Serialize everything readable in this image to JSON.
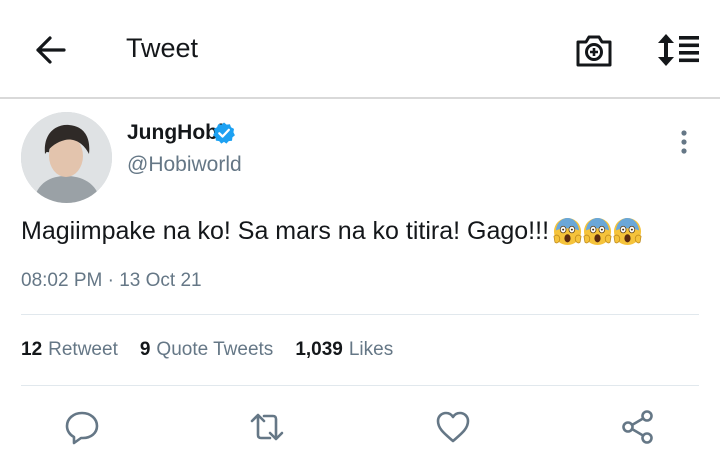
{
  "header": {
    "title": "Tweet",
    "back_icon": "arrow-left-icon",
    "camera_icon": "camera-plus-icon",
    "sort_icon": "sort-list-icon"
  },
  "tweet": {
    "display_name": "JungHobi",
    "verified": true,
    "handle": "@Hobiworld",
    "text": "Magiimpake na ko! Sa mars na ko titira! Gago!!!",
    "emojis": [
      "😱",
      "😱",
      "😱"
    ],
    "timestamp": "08:02 PM · 13 Oct 21"
  },
  "stats": [
    {
      "count": "12",
      "label": "Retweet"
    },
    {
      "count": "9",
      "label": "Quote Tweets"
    },
    {
      "count": "1,039",
      "label": "Likes"
    }
  ],
  "actions": [
    "reply-icon",
    "retweet-icon",
    "like-icon",
    "share-icon"
  ],
  "colors": {
    "verified": "#1da1f2",
    "secondary_text": "#657786",
    "primary_text": "#14171a",
    "divider": "#e1e8ed"
  }
}
